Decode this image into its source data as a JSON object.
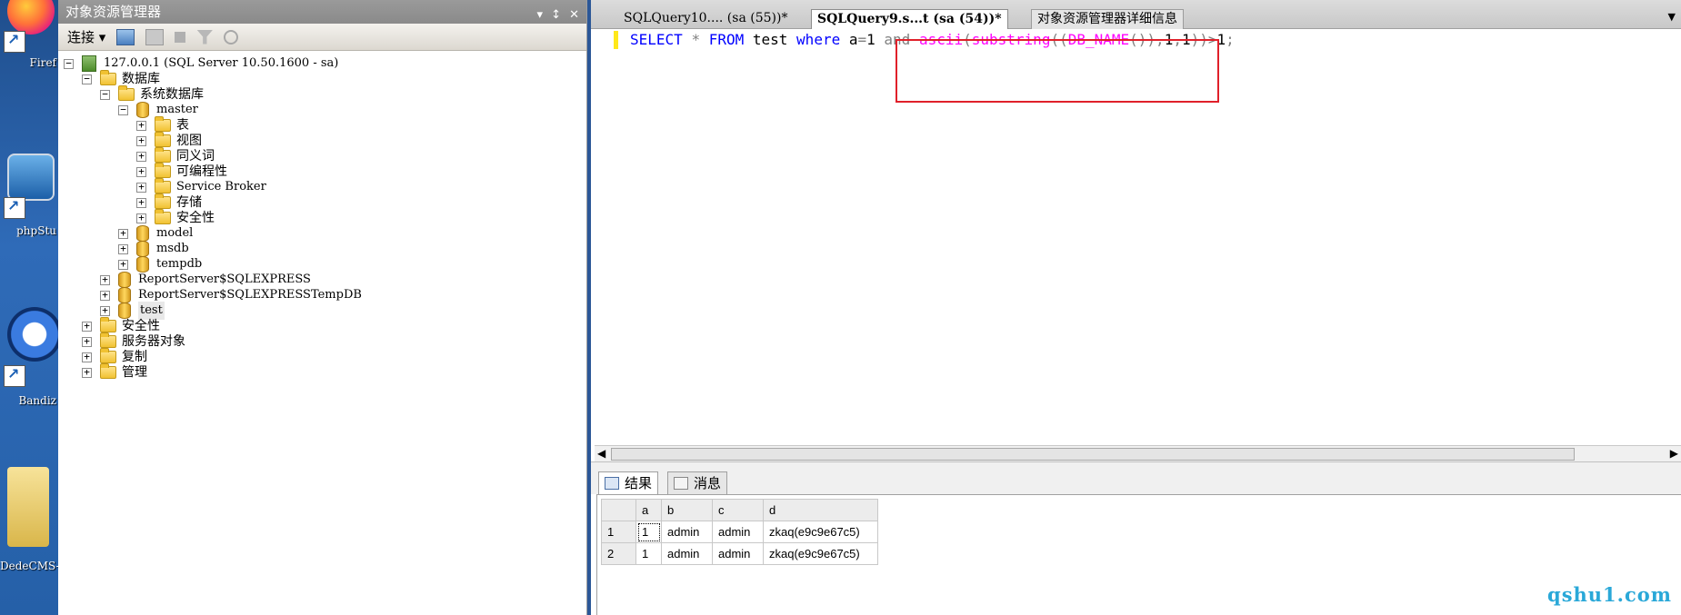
{
  "desktop": {
    "items": [
      {
        "label": "Firef",
        "icon": "firefox-icon"
      },
      {
        "label": "phpStu",
        "icon": "phpstudy-icon"
      },
      {
        "label": "Bandiz",
        "icon": "bandizip-icon"
      },
      {
        "label": "DedeCMS-V",
        "icon": "folder-icon"
      }
    ]
  },
  "object_explorer": {
    "title": "对象资源管理器",
    "title_buttons": [
      "▾",
      "↕",
      "✕"
    ],
    "toolbar": {
      "connect_label": "连接 ▾"
    },
    "tree": [
      {
        "label": "127.0.0.1 (SQL Server 10.50.1600 - sa)",
        "type": "server",
        "expander": "−",
        "level": 0
      },
      {
        "label": "数据库",
        "type": "folder",
        "expander": "−",
        "level": 1
      },
      {
        "label": "系统数据库",
        "type": "folder",
        "expander": "−",
        "level": 2
      },
      {
        "label": "master",
        "type": "db",
        "expander": "−",
        "level": 3
      },
      {
        "label": "表",
        "type": "folder",
        "expander": "+",
        "level": 4
      },
      {
        "label": "视图",
        "type": "folder",
        "expander": "+",
        "level": 4
      },
      {
        "label": "同义词",
        "type": "folder",
        "expander": "+",
        "level": 4
      },
      {
        "label": "可编程性",
        "type": "folder",
        "expander": "+",
        "level": 4
      },
      {
        "label": "Service Broker",
        "type": "folder",
        "expander": "+",
        "level": 4
      },
      {
        "label": "存储",
        "type": "folder",
        "expander": "+",
        "level": 4
      },
      {
        "label": "安全性",
        "type": "folder",
        "expander": "+",
        "level": 4
      },
      {
        "label": "model",
        "type": "db",
        "expander": "+",
        "level": 3
      },
      {
        "label": "msdb",
        "type": "db",
        "expander": "+",
        "level": 3
      },
      {
        "label": "tempdb",
        "type": "db",
        "expander": "+",
        "level": 3
      },
      {
        "label": "ReportServer$SQLEXPRESS",
        "type": "db",
        "expander": "+",
        "level": 2
      },
      {
        "label": "ReportServer$SQLEXPRESSTempDB",
        "type": "db",
        "expander": "+",
        "level": 2
      },
      {
        "label": "test",
        "type": "db",
        "expander": "+",
        "level": 2
      },
      {
        "label": "安全性",
        "type": "folder",
        "expander": "+",
        "level": 1
      },
      {
        "label": "服务器对象",
        "type": "folder",
        "expander": "+",
        "level": 1
      },
      {
        "label": "复制",
        "type": "folder",
        "expander": "+",
        "level": 1
      },
      {
        "label": "管理",
        "type": "folder",
        "expander": "+",
        "level": 1
      }
    ]
  },
  "tabs": [
    {
      "label": "SQLQuery10.... (sa (55))*",
      "active": false
    },
    {
      "label": "SQLQuery9.s...t (sa (54))*",
      "active": true
    },
    {
      "label": "对象资源管理器详细信息",
      "active": false
    }
  ],
  "editor": {
    "tokens": [
      {
        "t": "SELECT",
        "c": "kw"
      },
      {
        "t": " ",
        "c": "tx"
      },
      {
        "t": "*",
        "c": "op"
      },
      {
        "t": " ",
        "c": "tx"
      },
      {
        "t": "FROM",
        "c": "kw"
      },
      {
        "t": " test ",
        "c": "tx"
      },
      {
        "t": "where",
        "c": "kw"
      },
      {
        "t": " a",
        "c": "tx"
      },
      {
        "t": "=",
        "c": "op"
      },
      {
        "t": "1 ",
        "c": "tx"
      },
      {
        "t": "and",
        "c": "op"
      },
      {
        "t": " ",
        "c": "tx"
      },
      {
        "t": "ascii",
        "c": "fn"
      },
      {
        "t": "(",
        "c": "op"
      },
      {
        "t": "substring",
        "c": "fn"
      },
      {
        "t": "((",
        "c": "op"
      },
      {
        "t": "DB_NAME",
        "c": "fn"
      },
      {
        "t": "()),",
        "c": "op"
      },
      {
        "t": "1",
        "c": "tx"
      },
      {
        "t": ",",
        "c": "op"
      },
      {
        "t": "1",
        "c": "tx"
      },
      {
        "t": "))>",
        "c": "op"
      },
      {
        "t": "1",
        "c": "tx"
      },
      {
        "t": ";",
        "c": "op"
      }
    ]
  },
  "results": {
    "tabs": [
      {
        "label": "结果",
        "icon": "grid-icon",
        "active": true
      },
      {
        "label": "消息",
        "icon": "message-icon",
        "active": false
      }
    ],
    "columns": [
      "a",
      "b",
      "c",
      "d"
    ],
    "rows": [
      {
        "n": "1",
        "cells": [
          "1",
          "admin",
          "admin",
          "zkaq(e9c9e67c5)"
        ]
      },
      {
        "n": "2",
        "cells": [
          "1",
          "admin",
          "admin",
          "zkaq(e9c9e67c5)"
        ]
      }
    ]
  },
  "watermark": "qshu1.com",
  "colors": {
    "highlight": "#e0202a",
    "keyword": "#0000ff",
    "function": "#ff00ff",
    "operator": "#808080"
  }
}
